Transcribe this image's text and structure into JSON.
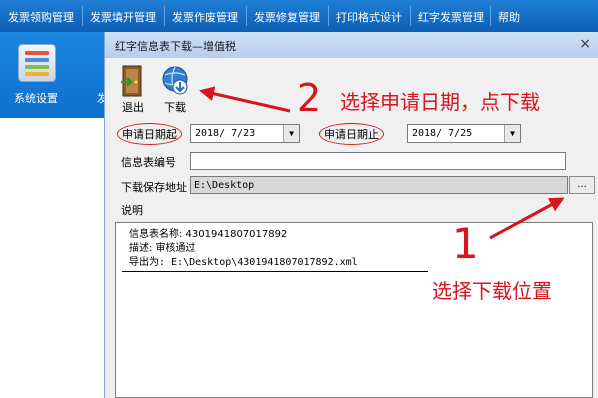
{
  "menu": [
    "发票领购管理",
    "发票填开管理",
    "发票作废管理",
    "发票修复管理",
    "打印格式设计",
    "红字发票管理",
    "帮助"
  ],
  "app": {
    "tile_label": "系统设置",
    "partial_label": "发"
  },
  "dialog": {
    "title": "红字信息表下载—增值税",
    "close_icon": "×",
    "toolbar": {
      "exit_label": "退出",
      "download_label": "下载"
    },
    "start_date_label": "申请日期起",
    "start_date_value": "2018/ 7/23",
    "end_date_label": "申请日期止",
    "end_date_value": "2018/ 7/25",
    "info_no_label": "信息表编号",
    "info_no_value": "",
    "save_path_label": "下载保存地址",
    "save_path_value": "E:\\Desktop",
    "browse_label": "...",
    "desc_label": "说明",
    "desc_lines": [
      "信息表名称: 4301941807017892",
      "描述: 审核通过",
      "导出为: E:\\Desktop\\4301941807017892.xml"
    ]
  },
  "annotations": {
    "step2_number": "2",
    "step2_text": "选择申请日期，点下载",
    "step1_number": "1",
    "step1_text": "选择下载位置",
    "color": "#d8141e"
  }
}
